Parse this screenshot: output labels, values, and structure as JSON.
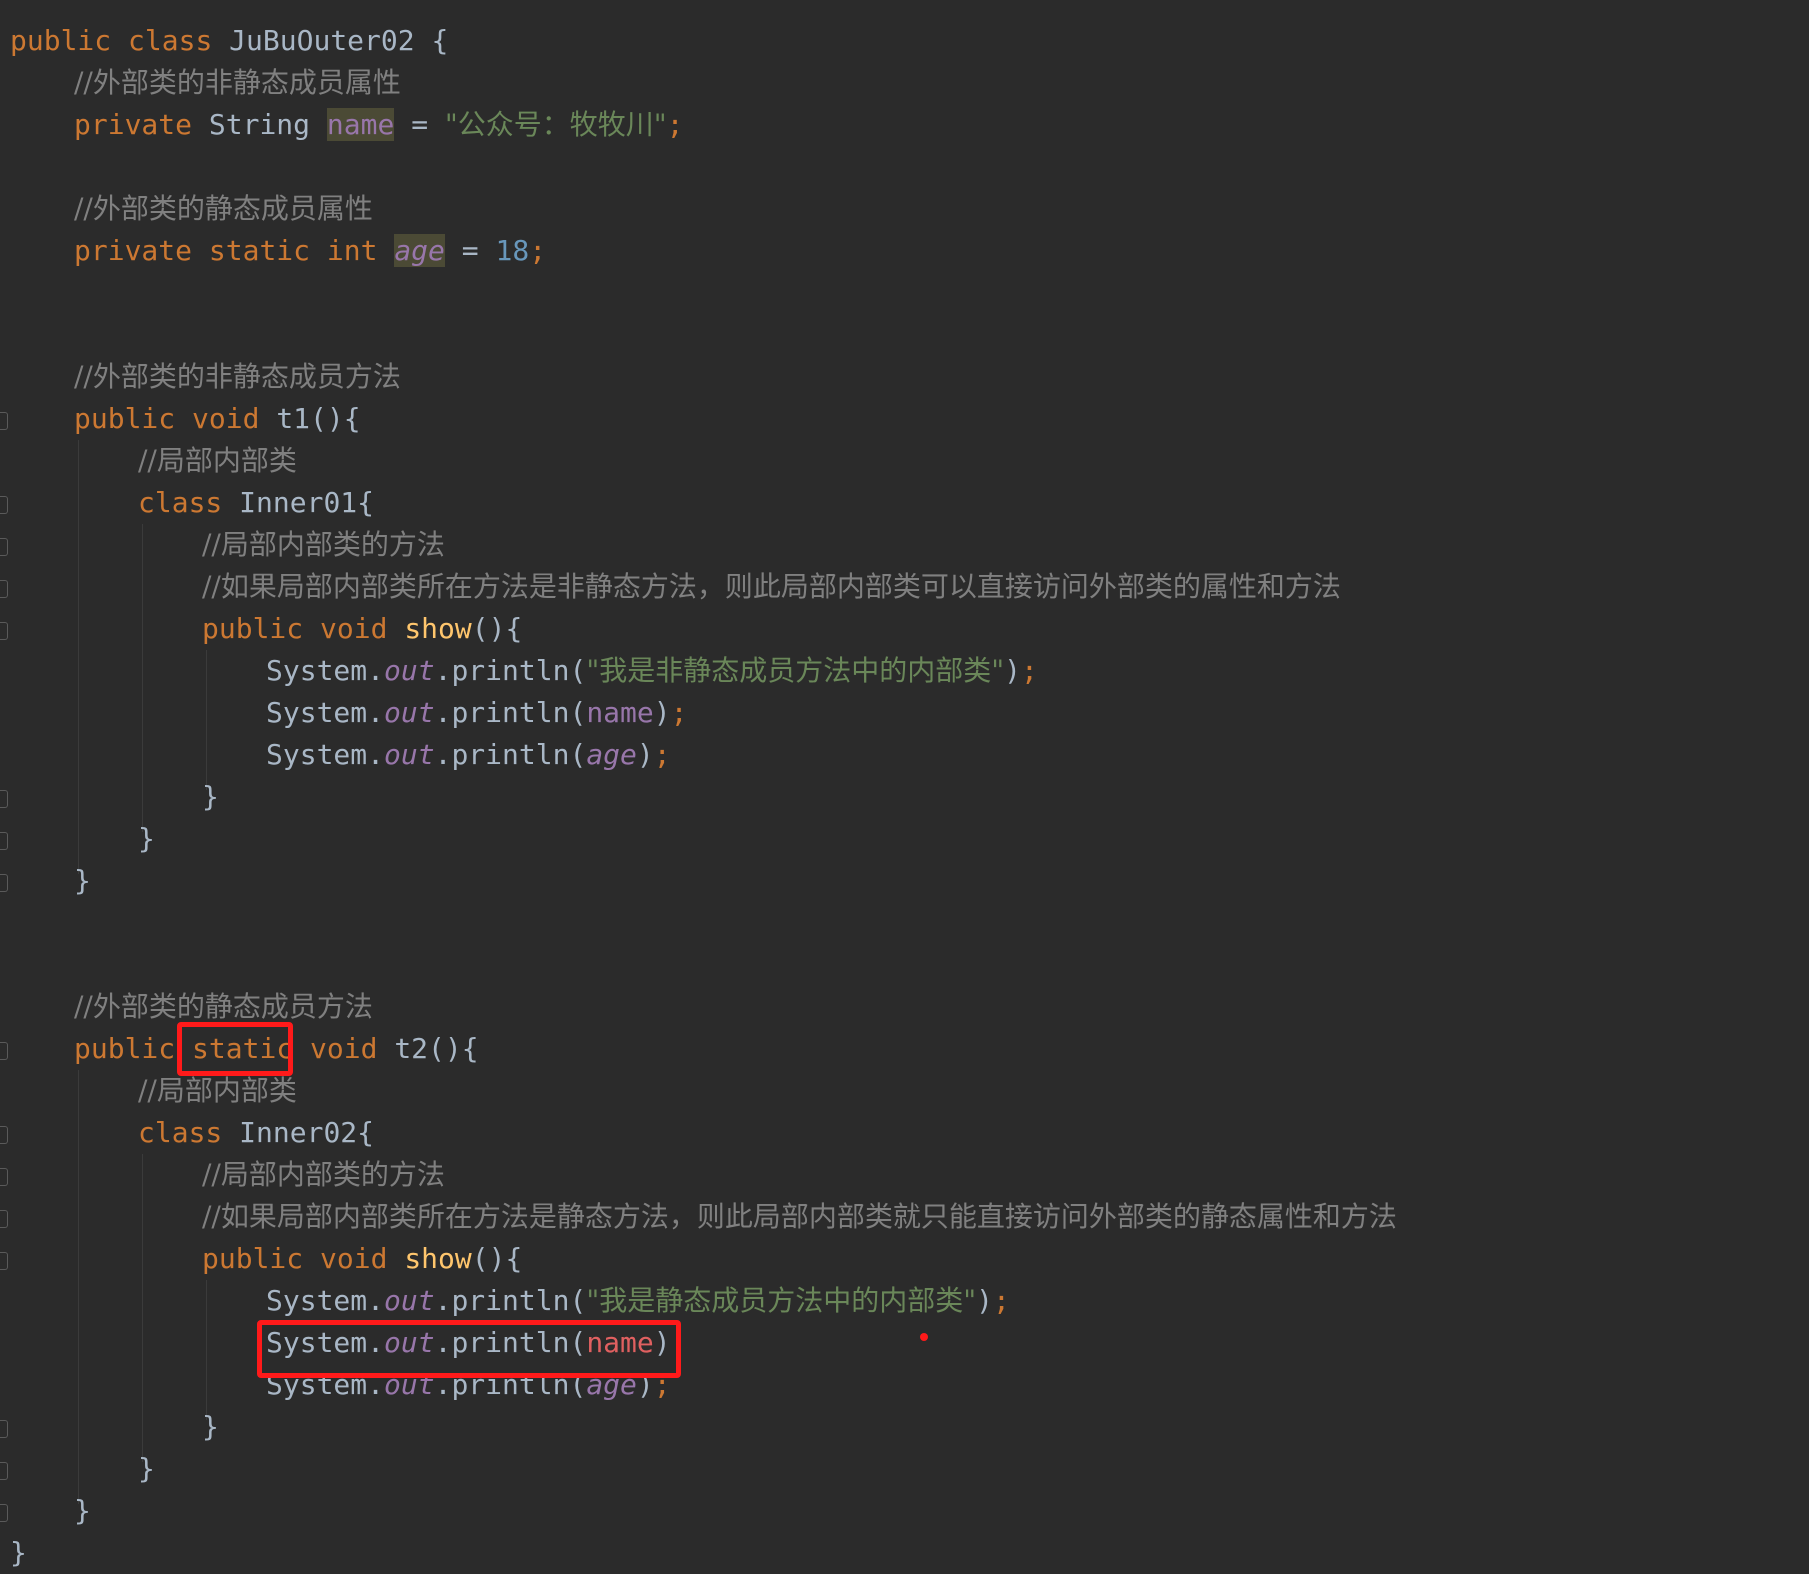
{
  "code": {
    "l1": {
      "kw1": "public",
      "kw2": "class",
      "name": "JuBuOuter02",
      "brace": "{"
    },
    "l2": {
      "comment": "//外部类的非静态成员属性"
    },
    "l3": {
      "kw1": "private",
      "type": "String",
      "field": "name",
      "eq": "=",
      "str": "\"公众号：牧牧川\"",
      "semi": ";"
    },
    "l4": {
      "comment": "//外部类的静态成员属性"
    },
    "l5": {
      "kw1": "private",
      "kw2": "static",
      "kw3": "int",
      "field": "age",
      "eq": "=",
      "num": "18",
      "semi": ";"
    },
    "l6": {
      "comment": "//外部类的非静态成员方法"
    },
    "l7": {
      "kw1": "public",
      "kw2": "void",
      "method": "t1",
      "parens": "(){"
    },
    "l8": {
      "comment": "//局部内部类"
    },
    "l9": {
      "kw1": "class",
      "name": "Inner01",
      "brace": "{"
    },
    "l10": {
      "comment": "//局部内部类的方法"
    },
    "l11": {
      "comment": "//如果局部内部类所在方法是非静态方法，则此局部内部类可以直接访问外部类的属性和方法"
    },
    "l12": {
      "kw1": "public",
      "kw2": "void",
      "method": "show",
      "parens": "(){"
    },
    "l13": {
      "sys": "System.",
      "out": "out",
      "call": ".println(",
      "arg": "\"我是非静态成员方法中的内部类\"",
      "close": ")",
      "semi": ";"
    },
    "l14": {
      "sys": "System.",
      "out": "out",
      "call": ".println(",
      "arg": "name",
      "close": ")",
      "semi": ";"
    },
    "l15": {
      "sys": "System.",
      "out": "out",
      "call": ".println(",
      "arg": "age",
      "close": ")",
      "semi": ";"
    },
    "l16": {
      "brace": "}"
    },
    "l17": {
      "brace": "}"
    },
    "l18": {
      "brace": "}"
    },
    "l19": {
      "comment": "//外部类的静态成员方法"
    },
    "l20": {
      "kw1": "public",
      "kw2": "static",
      "kw3": "void",
      "method": "t2",
      "parens": "(){"
    },
    "l21": {
      "comment": "//局部内部类"
    },
    "l22": {
      "kw1": "class",
      "name": "Inner02",
      "brace": "{"
    },
    "l23": {
      "comment": "//局部内部类的方法"
    },
    "l24": {
      "comment": "//如果局部内部类所在方法是静态方法，则此局部内部类就只能直接访问外部类的静态属性和方法"
    },
    "l25": {
      "kw1": "public",
      "kw2": "void",
      "method": "show",
      "parens": "(){"
    },
    "l26": {
      "sys": "System.",
      "out": "out",
      "call": ".println(",
      "arg": "\"我是静态成员方法中的内部类\"",
      "close": ")",
      "semi": ";"
    },
    "l27": {
      "sys": "System.",
      "out": "out",
      "call": ".println(",
      "arg": "name",
      "close": ")",
      "semi": ";"
    },
    "l28": {
      "sys": "System.",
      "out": "out",
      "call": ".println(",
      "arg": "age",
      "close": ")",
      "semi": ";"
    },
    "l29": {
      "brace": "}"
    },
    "l30": {
      "brace": "}"
    },
    "l31": {
      "brace": "}"
    },
    "l32": {
      "brace": "}"
    }
  },
  "colors": {
    "background": "#2b2b2b",
    "keyword": "#cc7832",
    "text": "#a9b7c6",
    "field": "#9876aa",
    "string": "#6a8759",
    "number": "#6897bb",
    "comment": "#808080",
    "method": "#ffc66d",
    "error": "#e06060",
    "annotation": "#ff1a1a"
  }
}
